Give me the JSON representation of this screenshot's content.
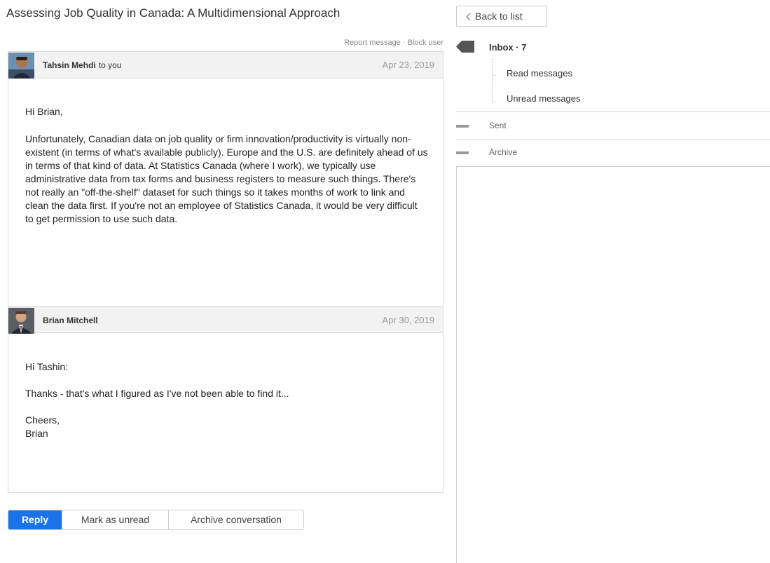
{
  "conversation": {
    "title": "Assessing Job Quality in Canada: A Multidimensional Approach",
    "report_message": "Report message",
    "separator": "·",
    "block_user": "Block user"
  },
  "messages": [
    {
      "sender": "Tahsin Mehdi",
      "recipient_note": "to you",
      "date": "Apr 23, 2019",
      "avatar": "avatar-tahsin",
      "paragraphs": [
        "Hi Brian,",
        "Unfortunately, Canadian data on job quality or firm innovation/productivity is virtually non-existent (in terms of what's available publicly). Europe and the U.S. are definitely ahead of us in terms of that kind of data. At Statistics Canada (where I work), we typically use administrative data from tax forms and business registers to measure such things. There's not really an \"off-the-shelf\" dataset for such things so it takes months of work to link and clean the data first. If you're not an employee of Statistics Canada, it would be very difficult to get permission to use such data."
      ]
    },
    {
      "sender": "Brian Mitchell",
      "recipient_note": "",
      "date": "Apr 30, 2019",
      "avatar": "avatar-brian",
      "paragraphs": [
        "Hi Tashin:",
        "Thanks - that's what I figured as I've not been able to find it...",
        "Cheers,",
        "Brian"
      ]
    }
  ],
  "actions": {
    "reply": "Reply",
    "mark_unread": "Mark as unread",
    "archive": "Archive conversation"
  },
  "nav": {
    "back": "Back to list",
    "inbox": "Inbox · 7",
    "read_messages": "Read messages",
    "unread_messages": "Unread messages",
    "sent": "Sent",
    "archive": "Archive"
  },
  "colors": {
    "primary": "#1a73e8",
    "header_bg": "#f2f2f2",
    "border": "#d9d9d9"
  }
}
